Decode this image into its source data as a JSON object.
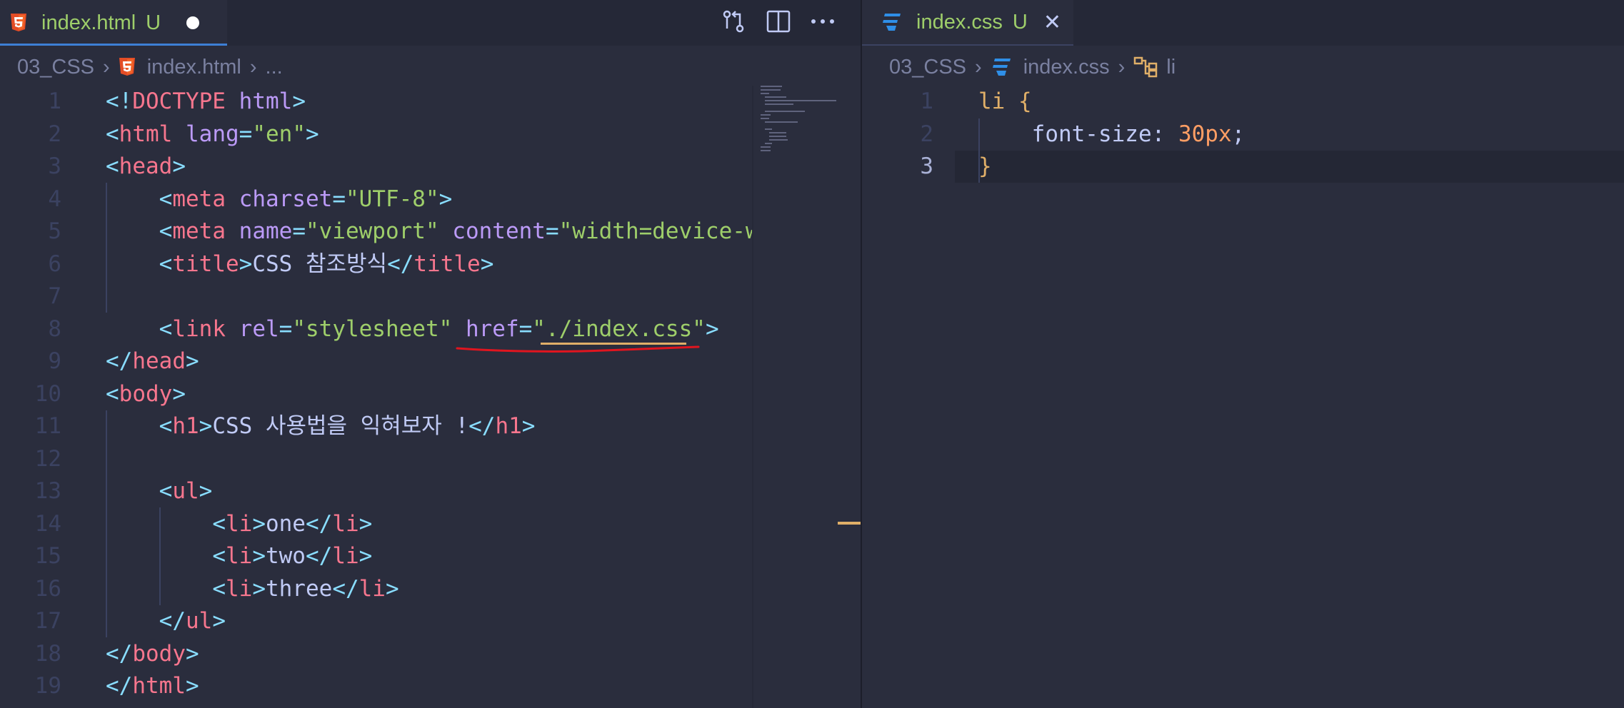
{
  "left": {
    "tab": {
      "name": "index.html",
      "status": "U"
    },
    "breadcrumb": {
      "folder": "03_CSS",
      "file": "index.html",
      "more": "..."
    },
    "lines": [
      {
        "n": "1",
        "tokens": [
          [
            "brk",
            "<!"
          ],
          [
            "tag",
            "DOCTYPE"
          ],
          [
            "txt",
            " "
          ],
          [
            "attr",
            "html"
          ],
          [
            "brk",
            ">"
          ]
        ]
      },
      {
        "n": "2",
        "tokens": [
          [
            "brk",
            "<"
          ],
          [
            "tag",
            "html"
          ],
          [
            "txt",
            " "
          ],
          [
            "attr",
            "lang"
          ],
          [
            "eq",
            "="
          ],
          [
            "str",
            "\"en\""
          ],
          [
            "brk",
            ">"
          ]
        ]
      },
      {
        "n": "3",
        "tokens": [
          [
            "brk",
            "<"
          ],
          [
            "tag",
            "head"
          ],
          [
            "brk",
            ">"
          ]
        ]
      },
      {
        "n": "4",
        "tokens": [
          [
            "txt",
            "    "
          ],
          [
            "brk",
            "<"
          ],
          [
            "tag",
            "meta"
          ],
          [
            "txt",
            " "
          ],
          [
            "attr",
            "charset"
          ],
          [
            "eq",
            "="
          ],
          [
            "str",
            "\"UTF-8\""
          ],
          [
            "brk",
            ">"
          ]
        ]
      },
      {
        "n": "5",
        "tokens": [
          [
            "txt",
            "    "
          ],
          [
            "brk",
            "<"
          ],
          [
            "tag",
            "meta"
          ],
          [
            "txt",
            " "
          ],
          [
            "attr",
            "name"
          ],
          [
            "eq",
            "="
          ],
          [
            "str",
            "\"viewport\""
          ],
          [
            "txt",
            " "
          ],
          [
            "attr",
            "content"
          ],
          [
            "eq",
            "="
          ],
          [
            "str",
            "\"width=device-w"
          ]
        ]
      },
      {
        "n": "6",
        "tokens": [
          [
            "txt",
            "    "
          ],
          [
            "brk",
            "<"
          ],
          [
            "tag",
            "title"
          ],
          [
            "brk",
            ">"
          ],
          [
            "txt",
            "CSS 참조방식"
          ],
          [
            "brk",
            "</"
          ],
          [
            "tag",
            "title"
          ],
          [
            "brk",
            ">"
          ]
        ]
      },
      {
        "n": "7",
        "tokens": []
      },
      {
        "n": "8",
        "tokens": [
          [
            "txt",
            "    "
          ],
          [
            "brk",
            "<"
          ],
          [
            "tag",
            "link"
          ],
          [
            "txt",
            " "
          ],
          [
            "attr",
            "rel"
          ],
          [
            "eq",
            "="
          ],
          [
            "str",
            "\"stylesheet\""
          ],
          [
            "txt",
            " "
          ],
          [
            "attr",
            "href"
          ],
          [
            "eq",
            "="
          ],
          [
            "str",
            "\"./index.css\""
          ],
          [
            "brk",
            ">"
          ]
        ]
      },
      {
        "n": "9",
        "tokens": [
          [
            "brk",
            "</"
          ],
          [
            "tag",
            "head"
          ],
          [
            "brk",
            ">"
          ]
        ]
      },
      {
        "n": "10",
        "tokens": [
          [
            "brk",
            "<"
          ],
          [
            "tag",
            "body"
          ],
          [
            "brk",
            ">"
          ]
        ]
      },
      {
        "n": "11",
        "tokens": [
          [
            "txt",
            "    "
          ],
          [
            "brk",
            "<"
          ],
          [
            "tag",
            "h1"
          ],
          [
            "brk",
            ">"
          ],
          [
            "txt",
            "CSS 사용법을 익혀보자 !"
          ],
          [
            "brk",
            "</"
          ],
          [
            "tag",
            "h1"
          ],
          [
            "brk",
            ">"
          ]
        ]
      },
      {
        "n": "12",
        "tokens": []
      },
      {
        "n": "13",
        "tokens": [
          [
            "txt",
            "    "
          ],
          [
            "brk",
            "<"
          ],
          [
            "tag",
            "ul"
          ],
          [
            "brk",
            ">"
          ]
        ]
      },
      {
        "n": "14",
        "tokens": [
          [
            "txt",
            "        "
          ],
          [
            "brk",
            "<"
          ],
          [
            "tag",
            "li"
          ],
          [
            "brk",
            ">"
          ],
          [
            "txt",
            "one"
          ],
          [
            "brk",
            "</"
          ],
          [
            "tag",
            "li"
          ],
          [
            "brk",
            ">"
          ]
        ]
      },
      {
        "n": "15",
        "tokens": [
          [
            "txt",
            "        "
          ],
          [
            "brk",
            "<"
          ],
          [
            "tag",
            "li"
          ],
          [
            "brk",
            ">"
          ],
          [
            "txt",
            "two"
          ],
          [
            "brk",
            "</"
          ],
          [
            "tag",
            "li"
          ],
          [
            "brk",
            ">"
          ]
        ]
      },
      {
        "n": "16",
        "tokens": [
          [
            "txt",
            "        "
          ],
          [
            "brk",
            "<"
          ],
          [
            "tag",
            "li"
          ],
          [
            "brk",
            ">"
          ],
          [
            "txt",
            "three"
          ],
          [
            "brk",
            "</"
          ],
          [
            "tag",
            "li"
          ],
          [
            "brk",
            ">"
          ]
        ]
      },
      {
        "n": "17",
        "tokens": [
          [
            "txt",
            "    "
          ],
          [
            "brk",
            "</"
          ],
          [
            "tag",
            "ul"
          ],
          [
            "brk",
            ">"
          ]
        ]
      },
      {
        "n": "18",
        "tokens": [
          [
            "brk",
            "</"
          ],
          [
            "tag",
            "body"
          ],
          [
            "brk",
            ">"
          ]
        ]
      },
      {
        "n": "19",
        "tokens": [
          [
            "brk",
            "</"
          ],
          [
            "tag",
            "html"
          ],
          [
            "brk",
            ">"
          ]
        ]
      }
    ]
  },
  "right": {
    "tab": {
      "name": "index.css",
      "status": "U"
    },
    "breadcrumb": {
      "folder": "03_CSS",
      "file": "index.css",
      "symbol": "li"
    },
    "lines": [
      {
        "n": "1",
        "tokens": [
          [
            "sel",
            "li"
          ],
          [
            "txt",
            " "
          ],
          [
            "brace",
            "{"
          ]
        ]
      },
      {
        "n": "2",
        "tokens": [
          [
            "txt",
            "    "
          ],
          [
            "prop",
            "font-size"
          ],
          [
            "txt",
            ": "
          ],
          [
            "num",
            "30px"
          ],
          [
            "txt",
            ";"
          ]
        ]
      },
      {
        "n": "3",
        "tokens": [
          [
            "brace",
            "}"
          ]
        ]
      }
    ]
  },
  "colors": {
    "background": "#2a2d3d",
    "annotation_underline": "#e0151f",
    "html_icon": "#e44d26",
    "css_icon": "#2f8fe8"
  },
  "icons": [
    "html5-icon",
    "css3-icon",
    "git-compare-icon",
    "split-editor-icon",
    "more-actions-icon",
    "close-icon",
    "symbol-field-icon"
  ]
}
